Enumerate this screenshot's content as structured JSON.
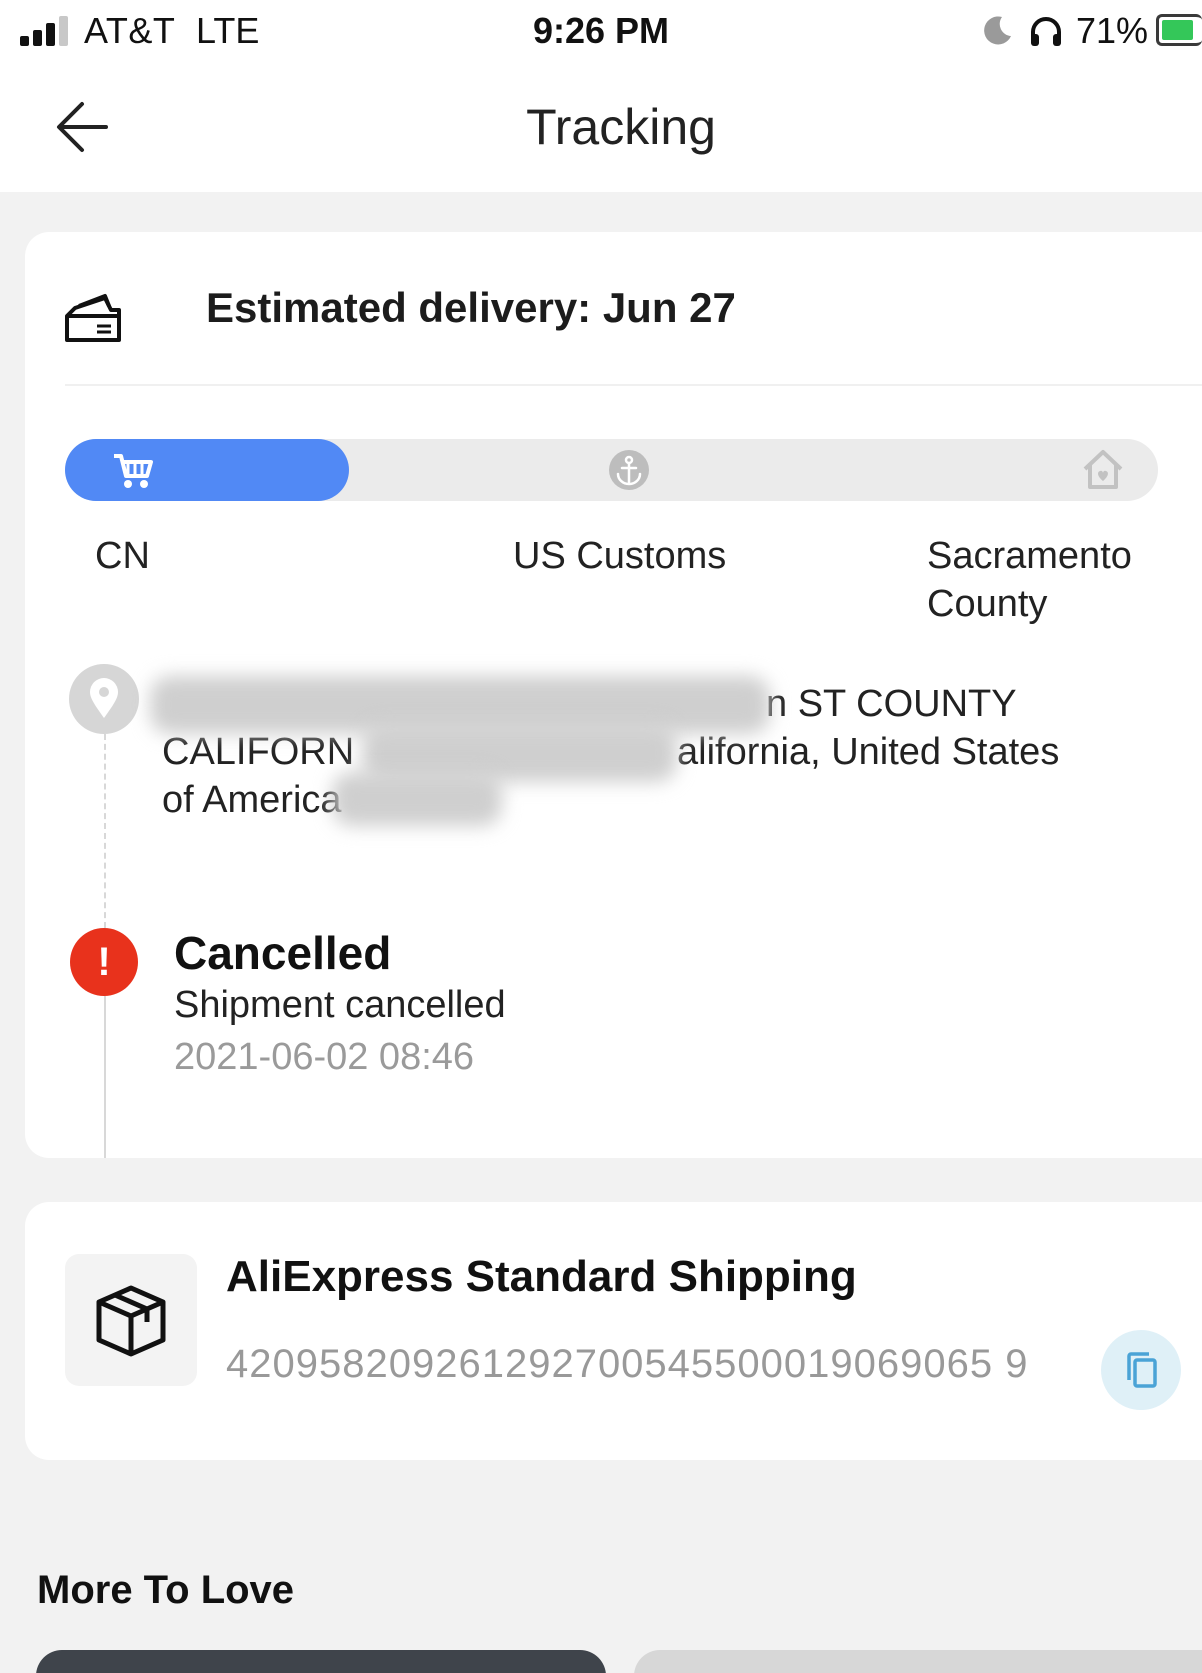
{
  "status_bar": {
    "carrier": "AT&T",
    "network": "LTE",
    "time": "9:26 PM",
    "battery_percent": "71%",
    "battery_level": 0.71,
    "icons": [
      "signal-icon",
      "moon-icon",
      "headphones-icon",
      "battery-charging-icon"
    ]
  },
  "nav": {
    "title": "Tracking",
    "back_icon": "arrow-left-icon"
  },
  "tracking_card": {
    "estimated_delivery": "Estimated delivery: Jun 27",
    "progress": {
      "fraction": 0.26,
      "fill_color": "#5189f5",
      "stages": [
        {
          "label": "CN",
          "icon": "cart-icon"
        },
        {
          "label": "US Customs",
          "icon": "anchor-icon"
        },
        {
          "label": "Sacramento County",
          "icon": "home-icon"
        }
      ]
    },
    "address": {
      "line1_visible": "n ST COUNTY",
      "line2_start": "CALIFORN",
      "line2_end": "alifornia,  United States",
      "line3": "of America"
    },
    "event": {
      "status": "Cancelled",
      "description": "Shipment cancelled",
      "timestamp": "2021-06-02 08:46",
      "status_color": "#e8321c"
    }
  },
  "shipping_card": {
    "carrier_name": "AliExpress Standard Shipping",
    "tracking_number": "420958209261292700545500019069065 9",
    "icons": [
      "package-icon",
      "copy-icon"
    ]
  },
  "more": {
    "title": "More To Love"
  }
}
